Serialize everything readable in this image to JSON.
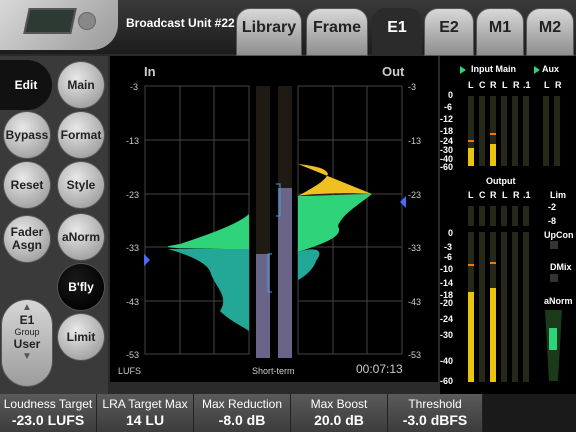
{
  "header": {
    "unit_title": "Broadcast Unit #22",
    "tabs": [
      {
        "label": "Library",
        "active": false
      },
      {
        "label": "Frame",
        "active": false
      },
      {
        "label": "E1",
        "active": true
      },
      {
        "label": "E2",
        "active": false
      },
      {
        "label": "M1",
        "active": false
      },
      {
        "label": "M2",
        "active": false
      }
    ]
  },
  "left_panel": {
    "edit": "Edit",
    "bypass": "Bypass",
    "reset": "Reset",
    "fader_assign": "Fader Asgn",
    "main": "Main",
    "format": "Format",
    "style": "Style",
    "anorm": "aNorm",
    "bfly": "B'fly",
    "limit": "Limit",
    "group": {
      "engine": "E1",
      "label": "Group",
      "value": "User"
    }
  },
  "display": {
    "in_label": "In",
    "out_label": "Out",
    "scale": [
      "-3",
      "-13",
      "-23",
      "-33",
      "-43",
      "-53"
    ],
    "lufs_label": "LUFS",
    "shortterm_label": "Short-term",
    "time": "00:07:13",
    "in_marker_value": -32,
    "out_marker_value": -23,
    "colors": {
      "green": "#2fd37a",
      "yellow": "#f0c020",
      "teal": "#23a898",
      "blue": "#4a6aff"
    }
  },
  "meters": {
    "input_main": "Input Main",
    "aux": "Aux",
    "channels_in": [
      "L",
      "C",
      "R",
      "L",
      "R",
      ".1",
      "L",
      "R"
    ],
    "scale_in": [
      "0",
      "-6",
      "-12",
      "-18",
      "-24",
      "-30",
      "-40",
      "-60"
    ],
    "output": "Output",
    "channels_out": [
      "L",
      "C",
      "R",
      "L",
      "R",
      ".1"
    ],
    "lim": "Lim",
    "lim_scale": [
      "-2",
      "-8"
    ],
    "upcon": "UpCon",
    "dmix": "DMix",
    "anorm": "aNorm",
    "scale_out": [
      "0",
      "-3",
      "-6",
      "-10",
      "-14",
      "-18",
      "-20",
      "-24",
      "-30",
      "-40",
      "-60"
    ]
  },
  "footer": [
    {
      "label": "Loudness Target",
      "value": "-23.0 LUFS"
    },
    {
      "label": "LRA Target Max",
      "value": "14 LU"
    },
    {
      "label": "Max Reduction",
      "value": "-8.0 dB"
    },
    {
      "label": "Max Boost",
      "value": "20.0 dB"
    },
    {
      "label": "Threshold",
      "value": "-3.0 dBFS"
    }
  ]
}
